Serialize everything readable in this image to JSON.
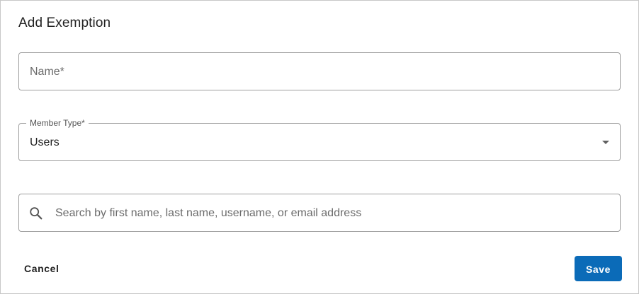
{
  "dialog": {
    "title": "Add Exemption",
    "name_field": {
      "placeholder": "Name*",
      "value": ""
    },
    "member_type_field": {
      "label": "Member Type*",
      "selected": "Users",
      "icon": "caret-down-icon"
    },
    "search_field": {
      "placeholder": "Search by first name, last name, username, or email address",
      "value": "",
      "icon": "search-icon"
    },
    "actions": {
      "cancel_label": "Cancel",
      "save_label": "Save"
    }
  },
  "colors": {
    "primary": "#0b6bb8",
    "border": "#9e9e9e",
    "text": "#222222",
    "placeholder": "#6b6b6b"
  }
}
